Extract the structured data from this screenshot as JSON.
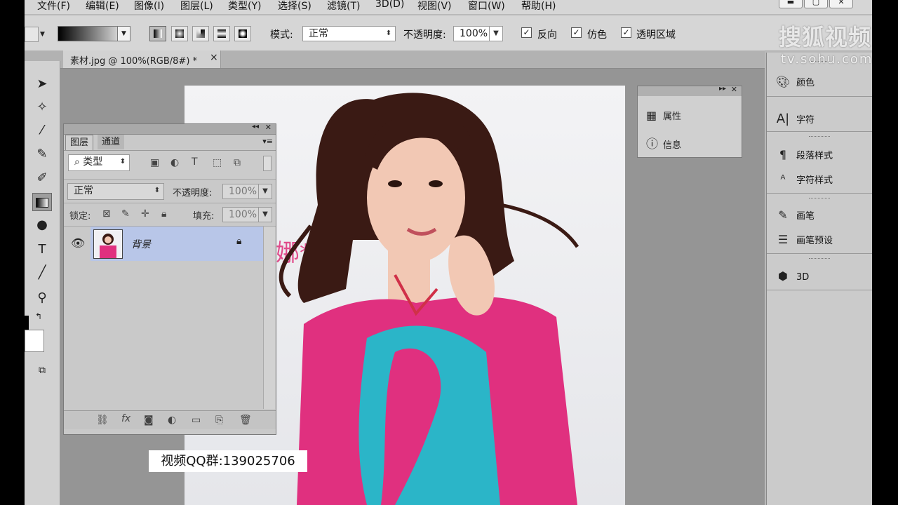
{
  "menu": [
    "文件(F)",
    "编辑(E)",
    "图像(I)",
    "图层(L)",
    "类型(Y)",
    "选择(S)",
    "滤镜(T)",
    "3D(D)",
    "视图(V)",
    "窗口(W)",
    "帮助(H)"
  ],
  "options": {
    "mode_label": "模式:",
    "mode_value": "正常",
    "opacity_label": "不透明度:",
    "opacity_value": "100%",
    "reverse_label": "反向",
    "dither_label": "仿色",
    "transparency_label": "透明区域"
  },
  "document_tab": {
    "title": "素材.jpg @ 100%(RGB/8#) *",
    "close": "×"
  },
  "layers_panel": {
    "tabs": [
      "图层",
      "通道"
    ],
    "filter_label": "类型",
    "blend_mode": "正常",
    "opacity_label": "不透明度:",
    "opacity_value": "100%",
    "lock_label": "锁定:",
    "fill_label": "填充:",
    "fill_value": "100%",
    "layer_name": "背景"
  },
  "properties_popup": {
    "items": [
      "属性",
      "信息"
    ]
  },
  "dock": {
    "items": [
      "颜色",
      "字符",
      "段落样式",
      "字符样式",
      "画笔",
      "画笔预设",
      "3D"
    ]
  },
  "watermark": {
    "brand": "搜狐视频",
    "url": "tv.sohu.com"
  },
  "overlay": {
    "qq_text": "视频QQ群:139025706"
  },
  "photo_text": "娜*",
  "colors": {
    "shirt": "#e0307f",
    "print": "#2bb5c8",
    "hair": "#3a1a14",
    "skin": "#f2c8b4",
    "layer_sel": "#b8c6e8"
  }
}
